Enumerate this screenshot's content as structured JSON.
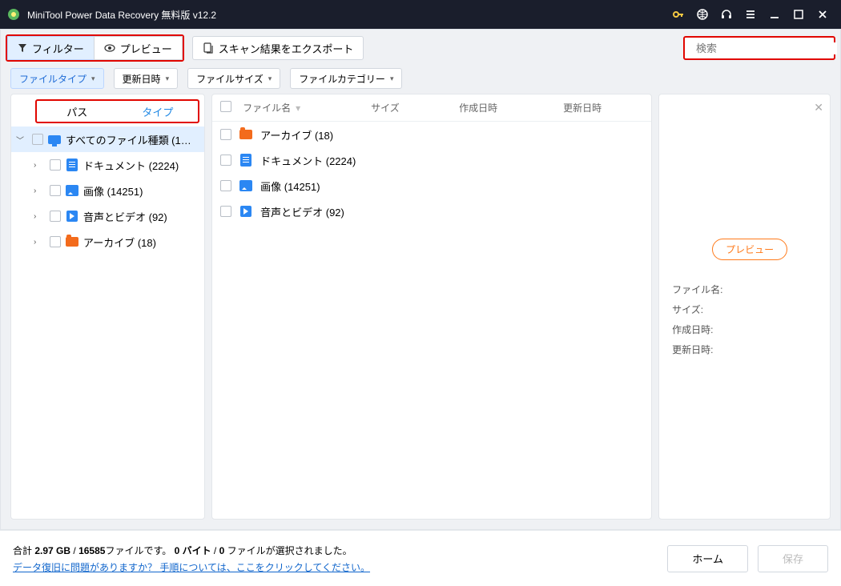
{
  "app": {
    "title": "MiniTool Power Data Recovery 無料版 v12.2"
  },
  "toolbar": {
    "filter": "フィルター",
    "preview": "プレビュー",
    "export": "スキャン結果をエクスポート"
  },
  "search": {
    "placeholder": "検索"
  },
  "filters": {
    "file_type": "ファイルタイプ",
    "modified": "更新日時",
    "file_size": "ファイルサイズ",
    "category": "ファイルカテゴリー"
  },
  "tabs": {
    "path": "パス",
    "type": "タイプ"
  },
  "tree": {
    "root": "すべてのファイル種類 (1…",
    "items": [
      {
        "label": "ドキュメント (2224)",
        "icon": "doc"
      },
      {
        "label": "画像 (14251)",
        "icon": "img"
      },
      {
        "label": "音声とビデオ (92)",
        "icon": "av"
      },
      {
        "label": "アーカイブ (18)",
        "icon": "arc"
      }
    ]
  },
  "columns": {
    "name": "ファイル名",
    "size": "サイズ",
    "created": "作成日時",
    "modified": "更新日時"
  },
  "files": [
    {
      "name": "アーカイブ (18)",
      "icon": "arc"
    },
    {
      "name": "ドキュメント (2224)",
      "icon": "doc"
    },
    {
      "name": "画像 (14251)",
      "icon": "img"
    },
    {
      "name": "音声とビデオ (92)",
      "icon": "av"
    }
  ],
  "detail": {
    "preview_btn": "プレビュー",
    "fields": {
      "name": "ファイル名:",
      "size": "サイズ:",
      "created": "作成日時:",
      "modified": "更新日時:"
    }
  },
  "footer": {
    "status_prefix": "合計 ",
    "total_size": "2.97 GB",
    "sep1": " / ",
    "total_files": "16585",
    "status_mid": "ファイルです。 ",
    "sel_bytes": "0 バイト",
    "sep2": "  / ",
    "sel_files": "0",
    "status_suffix": " ファイルが選択されました。",
    "help_link": "データ復旧に問題がありますか？ 手順については、ここをクリックしてください。",
    "home": "ホーム",
    "save": "保存"
  }
}
